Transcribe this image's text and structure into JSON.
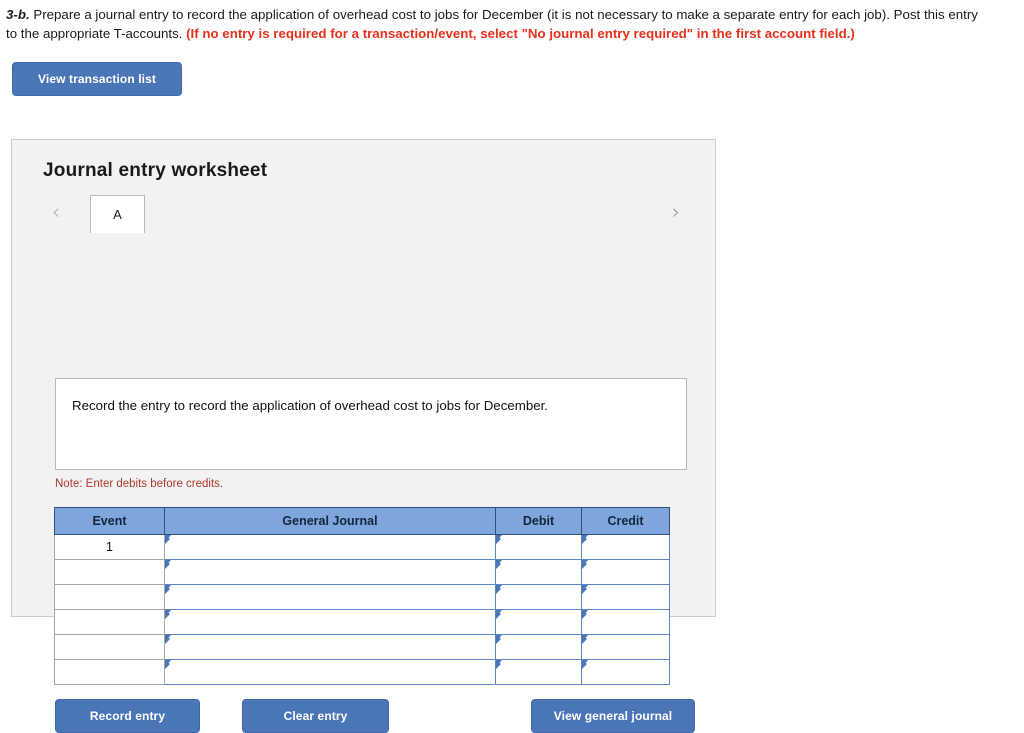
{
  "prompt": {
    "label": "3-b.",
    "text_part1": " Prepare a journal entry to record the application of overhead cost to jobs for December (it is not necessary to make a separate entry for each job). Post this entry to the appropriate T-accounts. ",
    "red_text": "(If no entry is required for a transaction/event, select \"No journal entry required\" in the first account field.)"
  },
  "toolbar": {
    "view_transaction_list": "View transaction list"
  },
  "worksheet": {
    "title": "Journal entry worksheet",
    "prev_arrow": "‹",
    "next_arrow": "›",
    "tabs": [
      {
        "label": "A",
        "active": true
      }
    ],
    "instruction": "Record the entry to record the application of overhead cost to jobs for December.",
    "note": "Note: Enter debits before credits.",
    "table": {
      "headers": [
        "Event",
        "General Journal",
        "Debit",
        "Credit"
      ],
      "rows": [
        {
          "event": "1",
          "general_journal": "",
          "debit": "",
          "credit": ""
        },
        {
          "event": "",
          "general_journal": "",
          "debit": "",
          "credit": ""
        },
        {
          "event": "",
          "general_journal": "",
          "debit": "",
          "credit": ""
        },
        {
          "event": "",
          "general_journal": "",
          "debit": "",
          "credit": ""
        },
        {
          "event": "",
          "general_journal": "",
          "debit": "",
          "credit": ""
        },
        {
          "event": "",
          "general_journal": "",
          "debit": "",
          "credit": ""
        }
      ]
    },
    "actions": {
      "record_entry": "Record entry",
      "clear_entry": "Clear entry",
      "view_general_journal": "View general journal"
    }
  },
  "colors": {
    "button_blue": "#4a76b8",
    "header_blue": "#7fa6dc",
    "input_border_blue": "#5b85c4",
    "panel_bg": "#f2f2f2",
    "red_text": "#e8311a",
    "note_red": "#b03a2e"
  }
}
